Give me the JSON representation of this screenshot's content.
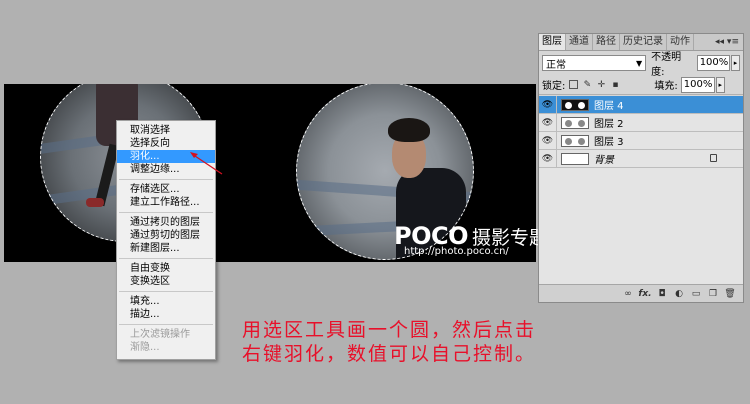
{
  "canvas": {
    "watermark_brand": "POCO",
    "watermark_sub": "摄影专题",
    "watermark_url": "http://photo.poco.cn/"
  },
  "context_menu": {
    "groups": [
      [
        {
          "label": "取消选择"
        },
        {
          "label": "选择反向"
        },
        {
          "label": "羽化...",
          "active": true
        },
        {
          "label": "调整边缘..."
        }
      ],
      [
        {
          "label": "存储选区..."
        },
        {
          "label": "建立工作路径..."
        }
      ],
      [
        {
          "label": "通过拷贝的图层"
        },
        {
          "label": "通过剪切的图层"
        },
        {
          "label": "新建图层..."
        }
      ],
      [
        {
          "label": "自由变换"
        },
        {
          "label": "变换选区"
        }
      ],
      [
        {
          "label": "填充..."
        },
        {
          "label": "描边..."
        }
      ],
      [
        {
          "label": "上次滤镜操作",
          "disabled": true
        },
        {
          "label": "渐隐...",
          "disabled": true
        }
      ]
    ]
  },
  "layers_panel": {
    "tabs": [
      "图层",
      "通道",
      "路径",
      "历史记录",
      "动作"
    ],
    "active_tab": "图层",
    "tab_controls": "◂◂ ▾≡",
    "blend_mode": "正常",
    "opacity_label": "不透明度:",
    "opacity_value": "100%",
    "lock_label": "锁定:",
    "fill_label": "填充:",
    "fill_value": "100%",
    "layers": [
      {
        "name": "图层 4",
        "selected": true,
        "thumb": "mask-dark"
      },
      {
        "name": "图层 2",
        "selected": false,
        "thumb": "light"
      },
      {
        "name": "图层 3",
        "selected": false,
        "thumb": "light"
      },
      {
        "name": "背景",
        "selected": false,
        "thumb": "white",
        "italic": true,
        "locked": true
      }
    ]
  },
  "caption": {
    "line1": "用选区工具画一个圆，然后点击",
    "line2": "右键羽化，数值可以自己控制。"
  },
  "colors": {
    "accent": "#3399ff",
    "caption": "#e8102a",
    "background": "#b1b1b1"
  }
}
